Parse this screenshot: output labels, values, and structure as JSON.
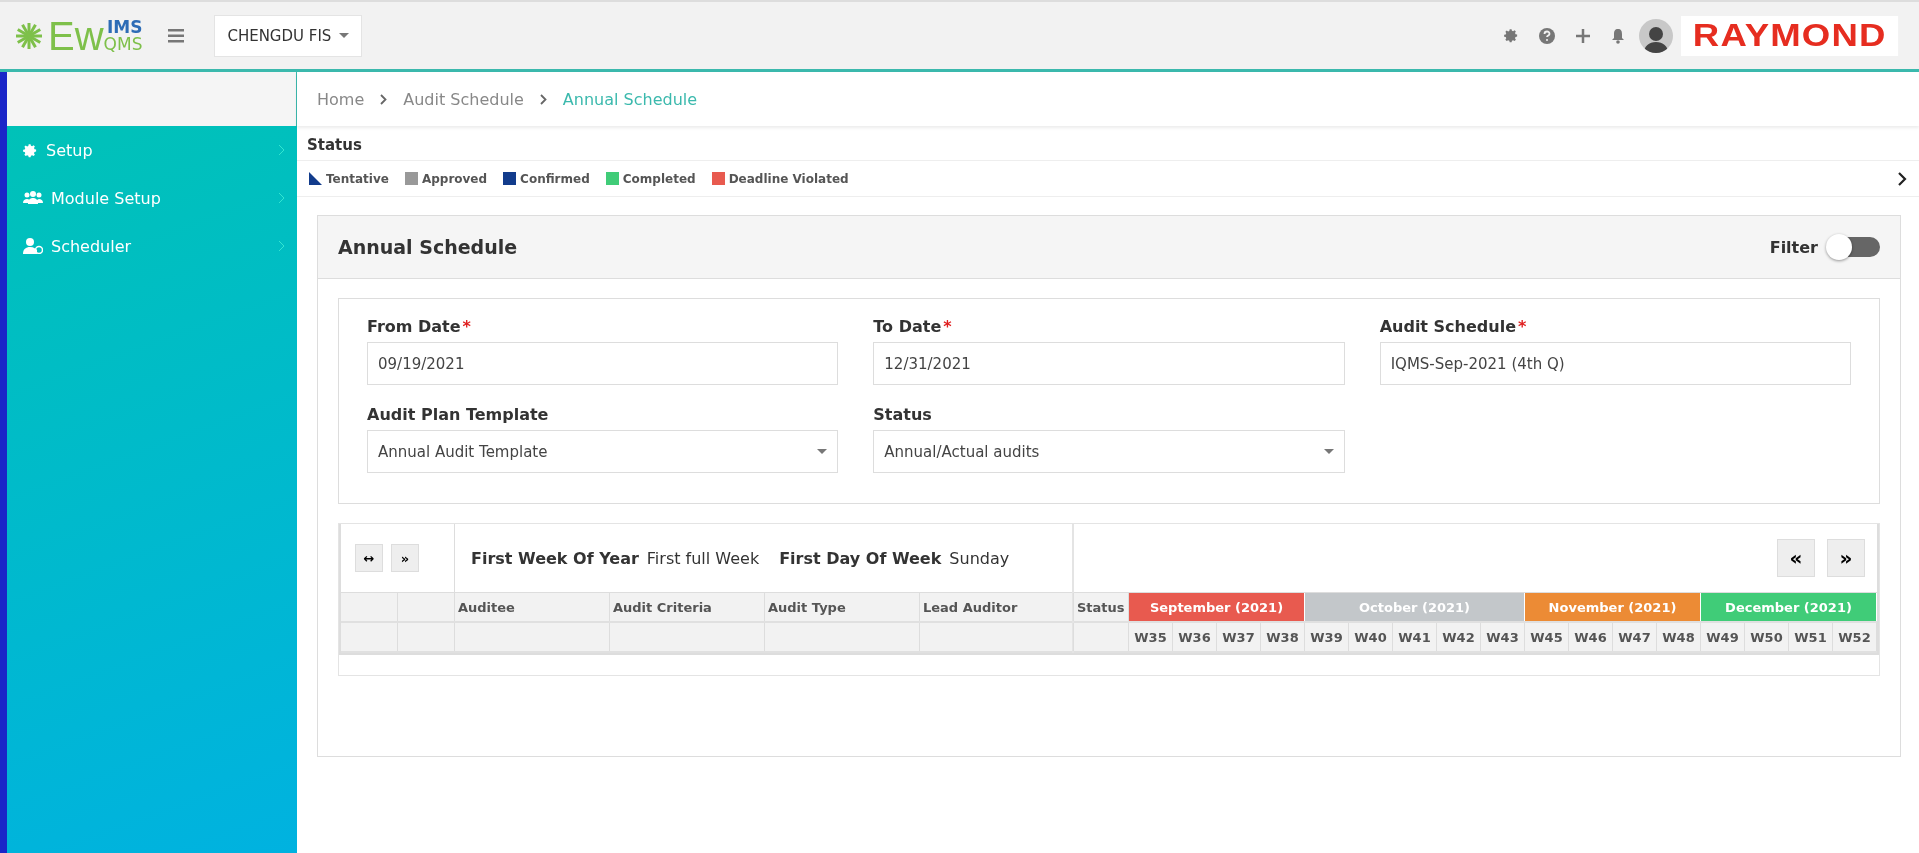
{
  "header": {
    "logo": {
      "main": "Ew",
      "top": "IMS",
      "bottom": "QMS"
    },
    "site_select": {
      "value": "CHENGDU FIS"
    },
    "brand": "RAYMOND"
  },
  "sidebar": {
    "items": [
      {
        "label": "Setup",
        "kind": "gear"
      },
      {
        "label": "Module Setup",
        "kind": "users"
      },
      {
        "label": "Scheduler",
        "kind": "user"
      }
    ]
  },
  "breadcrumb": [
    {
      "label": "Home",
      "selected": false
    },
    {
      "label": "Audit Schedule",
      "selected": false
    },
    {
      "label": "Annual Schedule",
      "selected": true
    }
  ],
  "status_legend": {
    "title": "Status",
    "items": [
      {
        "label": "Tentative",
        "kind": "triangle",
        "color": "#123c8c"
      },
      {
        "label": "Approved",
        "kind": "square",
        "color": "#999999"
      },
      {
        "label": "Confirmed",
        "kind": "square",
        "color": "#123c8c"
      },
      {
        "label": "Completed",
        "kind": "square",
        "color": "#40cc78"
      },
      {
        "label": "Deadline Violated",
        "kind": "square",
        "color": "#e85a4f"
      }
    ]
  },
  "card": {
    "title": "Annual Schedule",
    "filter": {
      "label": "Filter",
      "on": false
    },
    "fields": [
      {
        "label": "From Date",
        "required_mark": "*",
        "value": "09/19/2021",
        "kind": "text"
      },
      {
        "label": "To Date",
        "required_mark": "*",
        "value": "12/31/2021",
        "kind": "text"
      },
      {
        "label": "Audit Schedule",
        "required_mark": "*",
        "value": "IQMS-Sep-2021 (4th Q)",
        "kind": "text"
      },
      {
        "label": "Audit Plan Template",
        "value": "Annual Audit Template",
        "kind": "select"
      },
      {
        "label": "Status",
        "value": "Annual/Actual audits",
        "kind": "select"
      }
    ],
    "gantt": {
      "left_buttons": [
        "↔",
        "»"
      ],
      "settings": [
        {
          "label": "First Week Of Year",
          "value": "First full Week"
        },
        {
          "label": "First Day Of Week",
          "value": "Sunday"
        }
      ],
      "nav_buttons": [
        "«",
        "»"
      ],
      "columns": [
        "Auditee",
        "Audit Criteria",
        "Audit Type",
        "Lead Auditor"
      ],
      "status_column": "Status",
      "months": [
        {
          "label": "September (2021)",
          "color": "#e85a4f",
          "weeks": [
            "W35",
            "W36",
            "W37",
            "W38"
          ]
        },
        {
          "label": "October (2021)",
          "color": "#c3c7ca",
          "weeks": [
            "W39",
            "W40",
            "W41",
            "W42",
            "W43"
          ]
        },
        {
          "label": "November (2021)",
          "color": "#ec8b35",
          "weeks": [
            "W45",
            "W46",
            "W47",
            "W48"
          ]
        },
        {
          "label": "December (2021)",
          "color": "#40cc78",
          "weeks": [
            "W49",
            "W50",
            "W51",
            "W52"
          ]
        }
      ]
    }
  }
}
